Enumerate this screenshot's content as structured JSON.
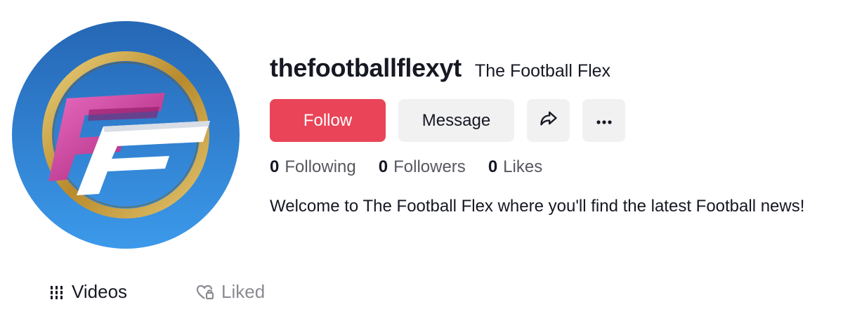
{
  "profile": {
    "username": "thefootballflexyt",
    "nickname": "The Football Flex",
    "bio": "Welcome to The Football Flex where you'll find the latest Football news!",
    "avatar_icon": "ff-logo-avatar"
  },
  "actions": {
    "follow_label": "Follow",
    "message_label": "Message",
    "share_icon": "share-arrow-icon",
    "more_icon": "more-dots-icon"
  },
  "stats": [
    {
      "value": "0",
      "label": "Following"
    },
    {
      "value": "0",
      "label": "Followers"
    },
    {
      "value": "0",
      "label": "Likes"
    }
  ],
  "tabs": [
    {
      "label": "Videos",
      "icon": "grid-icon",
      "active": true
    },
    {
      "label": "Liked",
      "icon": "heart-lock-icon",
      "active": false
    }
  ],
  "colors": {
    "follow_bg": "#ea4458",
    "secondary_bg": "#f1f1f2",
    "avatar_blue": "#2a7dd1",
    "avatar_gold": "#c9a33f",
    "logo_pink": "#d03a9a"
  }
}
